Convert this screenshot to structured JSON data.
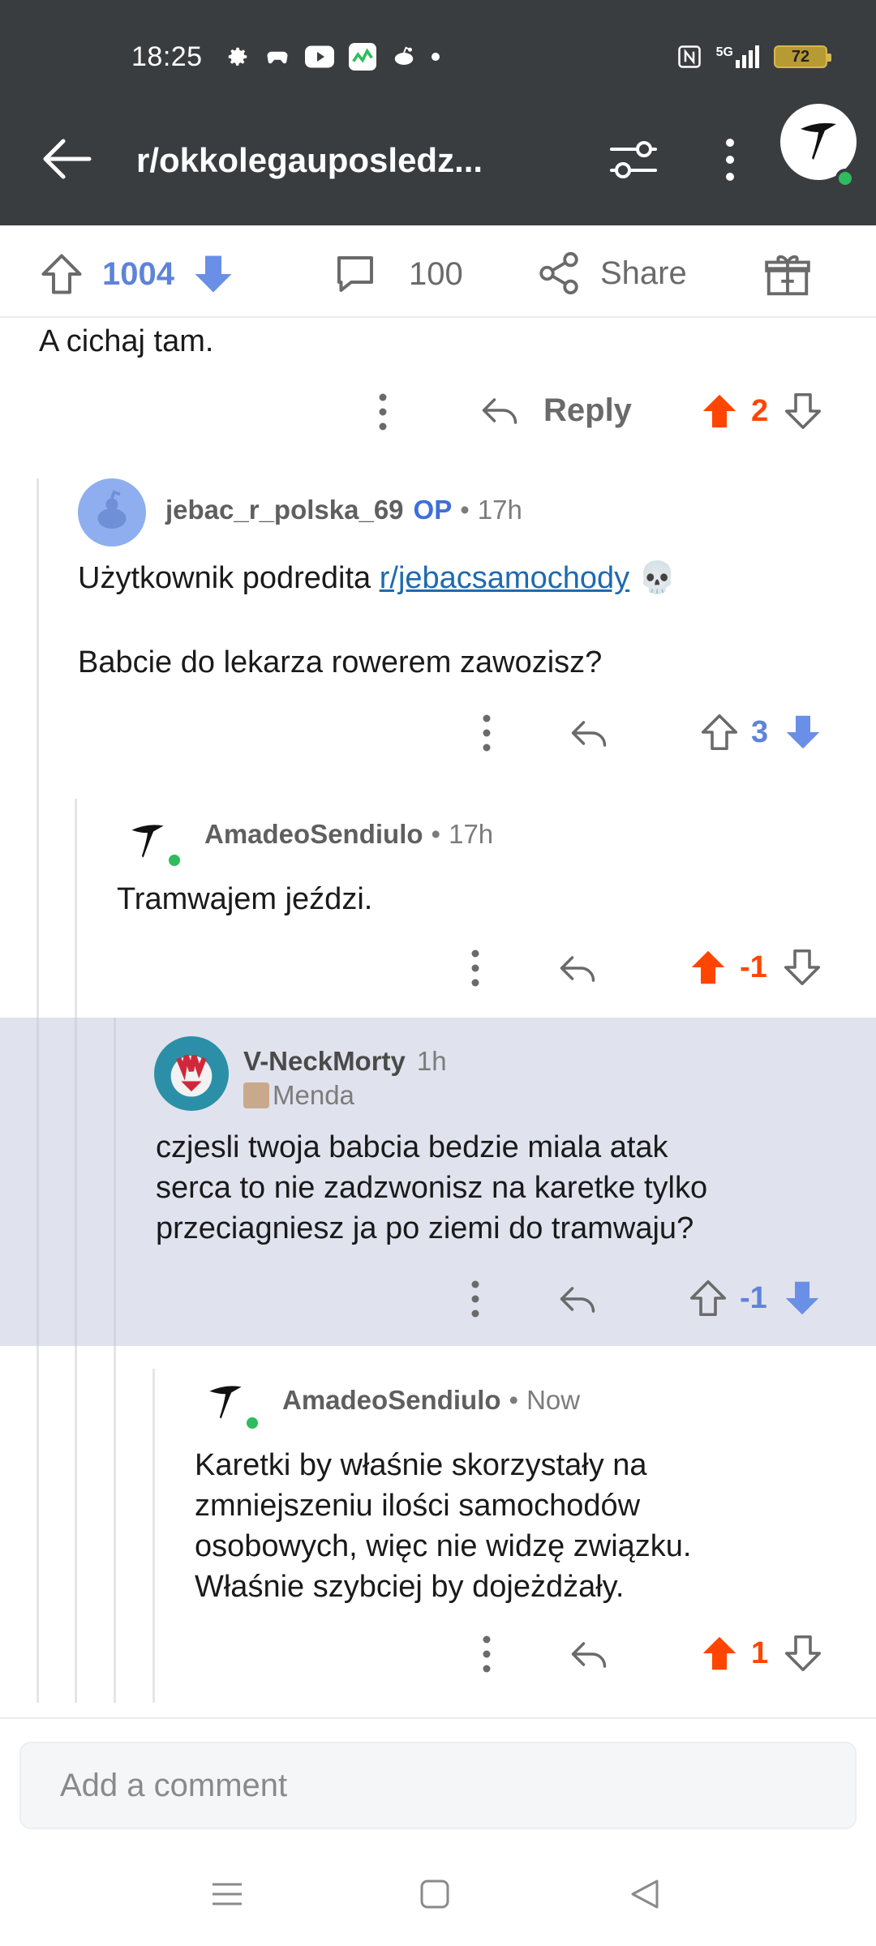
{
  "status_bar": {
    "time": "18:25",
    "network": "5G",
    "battery": "72"
  },
  "header": {
    "subreddit_title": "r/okkolegauposledz..."
  },
  "post_bar": {
    "upvotes": "1004",
    "comments": "100",
    "share_label": "Share"
  },
  "comments": [
    {
      "text": "A cichaj tam.",
      "reply_label": "Reply",
      "score": "2"
    },
    {
      "user": "jebac_r_polska_69",
      "op_badge": "OP",
      "time": "17h",
      "text_prefix": "Użytkownik podredita ",
      "link": "r/jebacsamochody",
      "text_suffix": " 💀",
      "text2": "Babcie do lekarza rowerem zawozisz?",
      "score": "3"
    },
    {
      "user": "AmadeoSendiulo",
      "time": "17h",
      "text": "Tramwajem jeździ.",
      "score": "-1"
    },
    {
      "user": "V-NeckMorty",
      "time": "1h",
      "flair": "Menda",
      "text_lines": [
        "czjesli twoja babcia bedzie miala atak",
        "serca to nie zadzwonisz na karetke tylko",
        "przeciagniesz ja po ziemi do tramwaju?"
      ],
      "score": "-1"
    },
    {
      "user": "AmadeoSendiulo",
      "time": "Now",
      "text_lines": [
        "Karetki by właśnie skorzystały na",
        "zmniejszeniu ilości samochodów",
        "osobowych, więc nie widzę związku.",
        "Właśnie szybciej by dojeżdżały."
      ],
      "score": "1"
    }
  ],
  "composer": {
    "placeholder": "Add a comment"
  },
  "colors": {
    "header_bg": "#3a3d40",
    "upvote_orange": "#ff4500",
    "downvote_blue": "#6a8fe6",
    "highlight_bg": "#e0e3ed",
    "online_green": "#2dbd5e"
  }
}
